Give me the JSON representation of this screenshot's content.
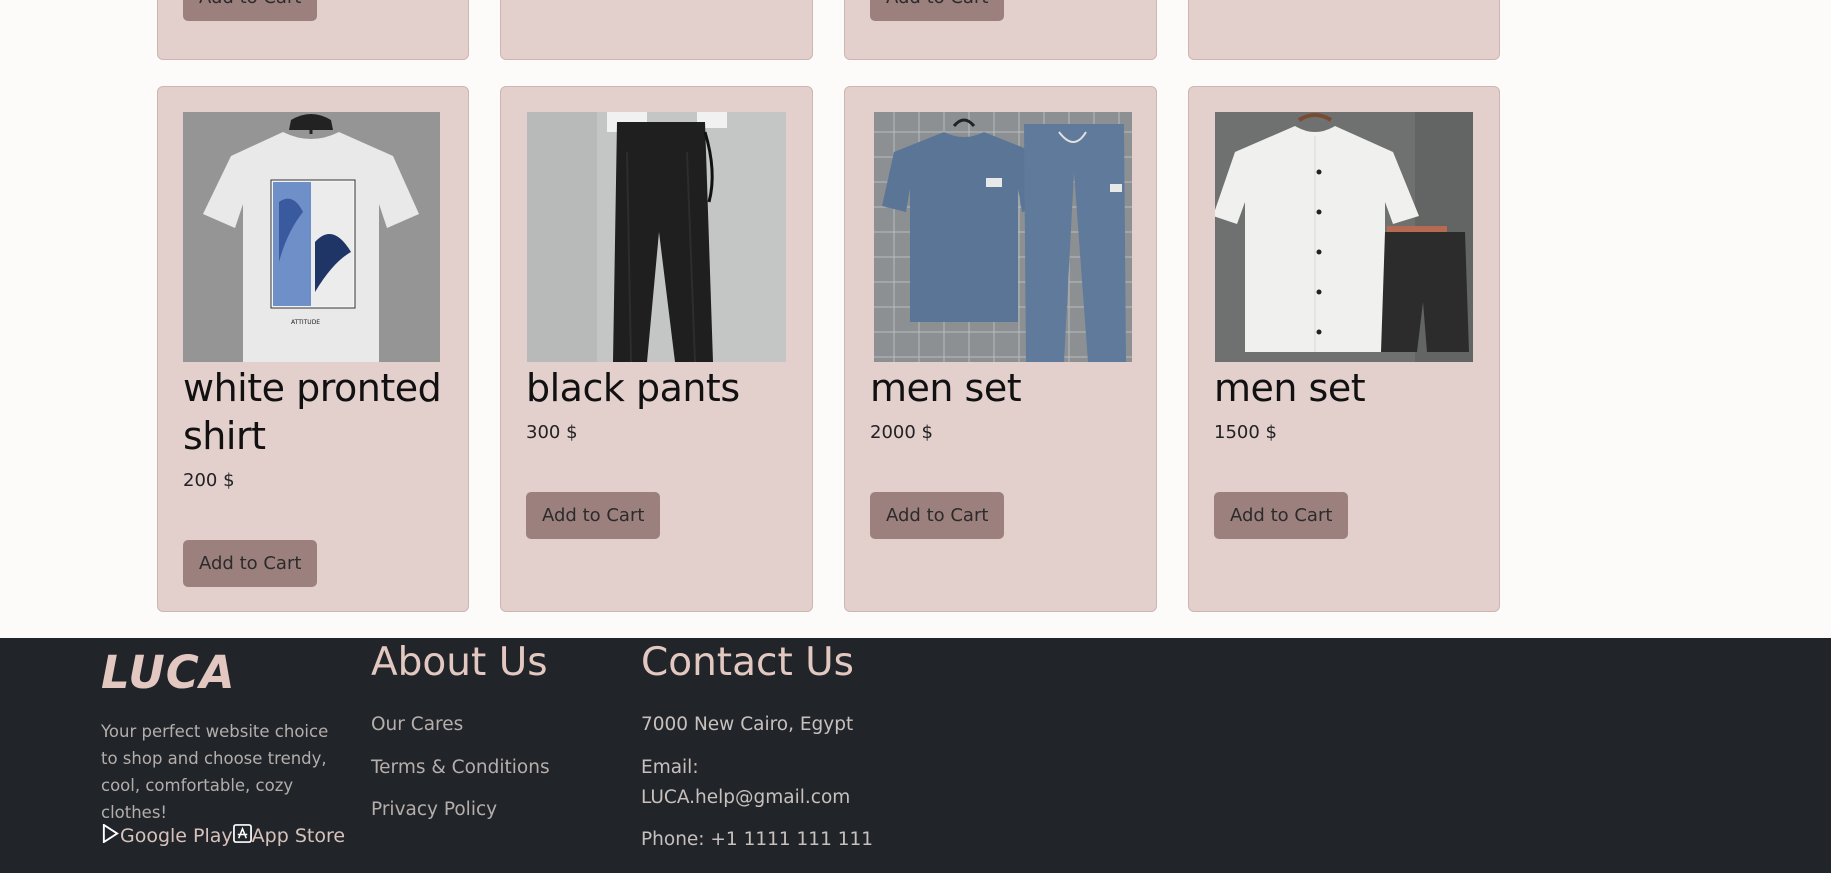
{
  "top_row": {
    "add_to_cart_label": "Add to Cart"
  },
  "products": [
    {
      "name": "white pronted shirt",
      "price": "200 $",
      "button": "Add to Cart",
      "image": "white-printed-tshirt"
    },
    {
      "name": "black pants",
      "price": "300 $",
      "button": "Add to Cart",
      "image": "black-pants"
    },
    {
      "name": "men set",
      "price": "2000 $",
      "button": "Add to Cart",
      "image": "blue-tshirt-pants-set"
    },
    {
      "name": "men set",
      "price": "1500 $",
      "button": "Add to Cart",
      "image": "white-shirt-shorts-set"
    }
  ],
  "footer": {
    "logo": "LUCA",
    "tagline": "Your perfect website choice to shop and choose trendy, cool, comfortable, cozy clothes!",
    "google_play": "Google Play",
    "app_store": "App Store",
    "about": {
      "heading": "About Us",
      "links": [
        "Our Cares",
        "Terms & Conditions",
        "Privacy Policy"
      ]
    },
    "contact": {
      "heading": "Contact Us",
      "address": "7000 New Cairo, Egypt",
      "email_label": "Email:",
      "email": "LUCA.help@gmail.com",
      "phone": "Phone: +1 1111 111 111"
    }
  },
  "colors": {
    "card_bg": "#e3d0cd",
    "button_bg": "#9c807d",
    "footer_bg": "#212529",
    "footer_accent": "#e3c8c1"
  }
}
